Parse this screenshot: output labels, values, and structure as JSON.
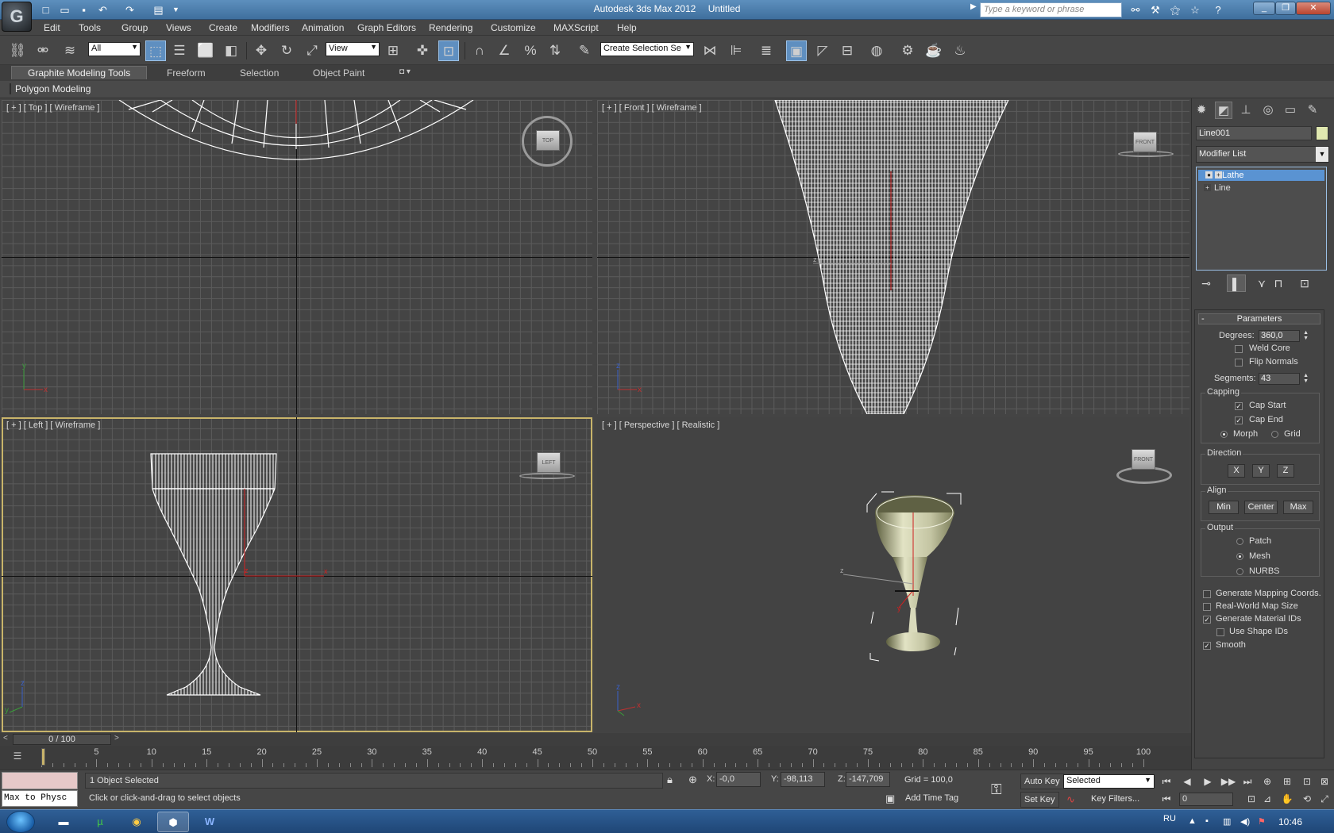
{
  "titlebar": {
    "app_name": "Autodesk 3ds Max  2012",
    "document": "Untitled",
    "search_placeholder": "Type a keyword or phrase"
  },
  "menu": [
    "Edit",
    "Tools",
    "Group",
    "Views",
    "Create",
    "Modifiers",
    "Animation",
    "Graph Editors",
    "Rendering",
    "Customize",
    "MAXScript",
    "Help"
  ],
  "toolbar": {
    "selection_filter": "All",
    "reference_coord": "View",
    "named_selection_placeholder": "Create Selection Se"
  },
  "ribbon": {
    "tabs": [
      "Graphite Modeling Tools",
      "Freeform",
      "Selection",
      "Object Paint"
    ],
    "panel_label": "Polygon Modeling"
  },
  "viewports": {
    "top": {
      "label": "[ + ] [ Top ] [ Wireframe ]",
      "cube": "TOP"
    },
    "front": {
      "label": "[ + ] [ Front ] [ Wireframe ]",
      "cube": "FRONT"
    },
    "left": {
      "label": "[ + ] [ Left ] [ Wireframe ]",
      "cube": "LEFT"
    },
    "perspective": {
      "label": "[ + ] [ Perspective ] [ Realistic ]",
      "cube": "FRONT"
    },
    "axis_labels": {
      "x": "x",
      "y": "y",
      "z": "z"
    }
  },
  "command_panel": {
    "object_name": "Line001",
    "object_color": "#e0e8b0",
    "modifier_list_label": "Modifier List",
    "stack": [
      {
        "name": "Lathe",
        "selected": true
      },
      {
        "name": "Line",
        "selected": false
      }
    ],
    "parameters": {
      "title": "Parameters",
      "collapse": "-",
      "degrees_label": "Degrees:",
      "degrees_value": "360,0",
      "weld_core": "Weld Core",
      "flip_normals": "Flip Normals",
      "segments_label": "Segments:",
      "segments_value": "43",
      "capping": {
        "title": "Capping",
        "cap_start": "Cap Start",
        "cap_end": "Cap End",
        "morph": "Morph",
        "grid": "Grid"
      },
      "direction": {
        "title": "Direction",
        "buttons": [
          "X",
          "Y",
          "Z"
        ]
      },
      "align": {
        "title": "Align",
        "buttons": [
          "Min",
          "Center",
          "Max"
        ]
      },
      "output": {
        "title": "Output",
        "patch": "Patch",
        "mesh": "Mesh",
        "nurbs": "NURBS"
      },
      "gen_mapping": "Generate Mapping Coords.",
      "real_world": "Real-World Map Size",
      "gen_material_ids": "Generate Material IDs",
      "use_shape_ids": "Use Shape IDs",
      "smooth": "Smooth"
    }
  },
  "timeline": {
    "slider_text": "0 / 100",
    "ticks": [
      5,
      10,
      15,
      20,
      25,
      30,
      35,
      40,
      45,
      50,
      55,
      60,
      65,
      70,
      75,
      80,
      85,
      90,
      95,
      100
    ]
  },
  "status": {
    "mini_listener": "Max to Physc",
    "selection": "1 Object Selected",
    "prompt": "Click or click-and-drag to select objects",
    "x_label": "X:",
    "x": "-0,0",
    "y_label": "Y:",
    "y": "-98,113",
    "z_label": "Z:",
    "z": "-147,709",
    "grid": "Grid = 100,0",
    "add_time_tag": "Add Time Tag",
    "auto_key": "Auto Key",
    "set_key": "Set Key",
    "key_mode": "Selected",
    "key_filters": "Key Filters...",
    "frame": "0"
  },
  "taskbar": {
    "language": "RU",
    "time": "10:46"
  },
  "colors": {
    "selection_highlight": "#5a93d2",
    "active_viewport_border": "#c8b46a",
    "object_wire": "#ffffff"
  }
}
